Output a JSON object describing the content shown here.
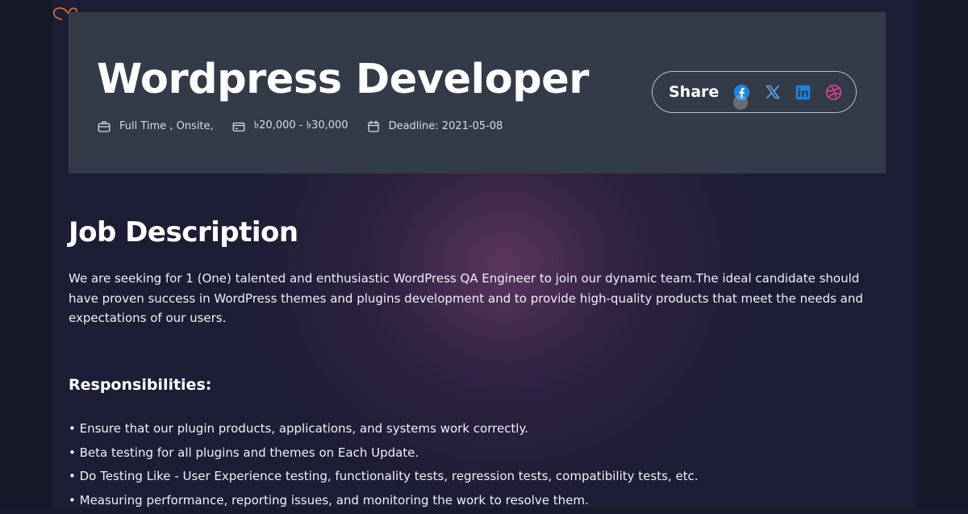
{
  "job": {
    "title": "Wordpress Developer",
    "meta": {
      "type": "Full Time , Onsite,",
      "salary": "৳20,000 - ৳30,000",
      "deadline": "Deadline: 2021-05-08"
    }
  },
  "share": {
    "label": "Share",
    "networks": [
      {
        "name": "facebook-icon",
        "color": "#1b86e6"
      },
      {
        "name": "x-icon",
        "color": "#5aa7e8"
      },
      {
        "name": "linkedin-icon",
        "color": "#1b86e6"
      },
      {
        "name": "dribbble-icon",
        "color": "#e8409b"
      }
    ]
  },
  "description": {
    "heading": "Job Description",
    "text": "We are seeking for 1 (One) talented and enthusiastic WordPress QA Engineer to join our dynamic team.The ideal candidate should have proven success in WordPress themes and plugins development and to provide high-quality products that meet the needs and expectations of our users."
  },
  "responsibilities": {
    "heading": "Responsibilities:",
    "items": [
      "Ensure that our plugin products, applications, and systems work correctly.",
      "Beta testing for all plugins and themes on Each Update.",
      "Do Testing Like - User Experience testing, functionality tests, regression tests, compatibility tests, etc.",
      "Measuring performance, reporting issues, and monitoring the work to resolve them."
    ]
  },
  "colors": {
    "background": "#1d1d35",
    "card": "#343b48",
    "accent_doodle": "#e8763a"
  }
}
